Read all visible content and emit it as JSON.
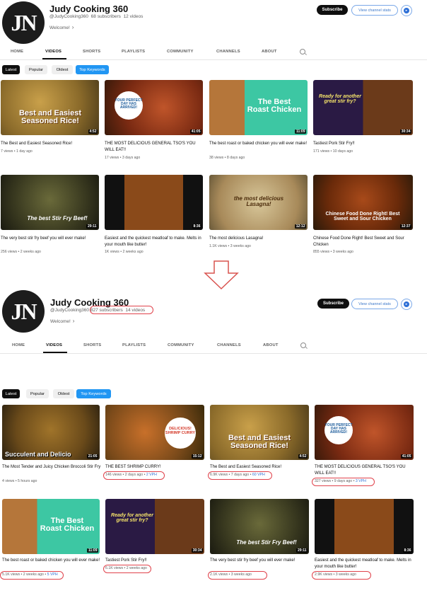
{
  "before": {
    "channel": {
      "name": "Judy Cooking 360",
      "handle": "@JudyCooking360",
      "subscribers": "68 subscribers",
      "videos": "12 videos",
      "welcome": "Welcome!",
      "subscribe_label": "Subscribe",
      "stats_label": "View channel stats"
    },
    "tabs": [
      "HOME",
      "VIDEOS",
      "SHORTS",
      "PLAYLISTS",
      "COMMUNITY",
      "CHANNELS",
      "ABOUT"
    ],
    "chips": [
      "Latest",
      "Popular",
      "Oldest",
      "Top Keywords"
    ],
    "videos": [
      {
        "title": "The Best and Easiest Seasoned Rice!",
        "meta": "7 views • 1 day ago",
        "duration": "4:52",
        "thumb_text": "Best and Easiest Seasoned Rice!"
      },
      {
        "title": "THE MOST DELICIOUS GENERAL TSO'S YOU WILL EAT!!",
        "meta": "17 views • 3 days ago",
        "duration": "41:05",
        "thumb_text": "YOUR PERFECT DAY HAS ARRIVED!"
      },
      {
        "title": "The best roast or baked chicken you will ever make!",
        "meta": "38 views • 8 days ago",
        "duration": "11:09",
        "thumb_text": "The Best Roast Chicken"
      },
      {
        "title": "Tastiest Pork Stir Fry!!",
        "meta": "171 views • 10 days ago",
        "duration": "30:34",
        "thumb_text": "Ready for another great stir fry?"
      },
      {
        "title": "The very best stir fry beef you will ever make!",
        "meta": "256 views • 2 weeks ago",
        "duration": "29:11",
        "thumb_text": "The best Stir Fry Beef!"
      },
      {
        "title": "Easiest and the quickest meatloaf to make. Melts in your mouth like butter!",
        "meta": "1K views • 2 weeks ago",
        "duration": "8:36",
        "thumb_text": ""
      },
      {
        "title": "The most delicious Lasagna!",
        "meta": "1.1K views • 3 weeks ago",
        "duration": "12:12",
        "thumb_text": "the most delicious Lasagna!"
      },
      {
        "title": "Chinese Food Done Right! Best Sweet and Sour Chicken",
        "meta": "855 views • 3 weeks ago",
        "duration": "12:37",
        "thumb_text": "Chinese Food Done Right! Best Sweet and Sour Chicken"
      }
    ]
  },
  "after": {
    "channel": {
      "name": "Judy Cooking 360",
      "handle": "@JudyCooking360",
      "subscribers": "827 subscribers",
      "videos": "14 videos",
      "welcome": "Welcome!",
      "subscribe_label": "Subscribe",
      "stats_label": "View channel stats"
    },
    "tabs": [
      "HOME",
      "VIDEOS",
      "SHORTS",
      "PLAYLISTS",
      "COMMUNITY",
      "CHANNELS",
      "ABOUT"
    ],
    "chips": [
      "Latest",
      "Popular",
      "Oldest",
      "Top Keywords"
    ],
    "videos": [
      {
        "title": "The Most Tender and Juicy Chicken Broccoli Stir Fry",
        "meta": "4 views • 5 hours ago",
        "vph": "",
        "duration": "21:05",
        "thumb_text": "Succulent and Delicio"
      },
      {
        "title": "THE BEST SHRIMP CURRY!",
        "meta": "146 views • 2 days ago •",
        "vph": "2 VPH",
        "duration": "15:12",
        "thumb_text": "DELICIOUS! SHRIMP CURRY"
      },
      {
        "title": "The Best and Easiest Seasoned Rice!",
        "meta": "6.9K views • 7 days ago •",
        "vph": "60 VPH",
        "duration": "4:52",
        "thumb_text": "Best and Easiest Seasoned Rice!"
      },
      {
        "title": "THE MOST DELICIOUS GENERAL TSO'S YOU WILL EAT!!",
        "meta": "327 views • 9 days ago •",
        "vph": "3 VPH",
        "duration": "41:05",
        "thumb_text": "YOUR PERFECT DAY HAS ARRIVED!"
      },
      {
        "title": "The best roast or baked chicken you will ever make!",
        "meta": "5.1K views • 2 weeks ago •",
        "vph": "5 VPH",
        "duration": "11:09",
        "thumb_text": "The Best Roast Chicken"
      },
      {
        "title": "Tastiest Pork Stir Fry!!",
        "meta": "6.1K views • 2 weeks ago",
        "vph": "",
        "duration": "30:34",
        "thumb_text": "Ready for another great stir fry?"
      },
      {
        "title": "The very best stir fry beef you will ever make!",
        "meta": "2.1K views • 3 weeks ago",
        "vph": "",
        "duration": "29:11",
        "thumb_text": "The best Stir Fry Beef!"
      },
      {
        "title": "Easiest and the quickest meatloaf to make. Melts in your mouth like butter!",
        "meta": "2.9K views • 3 weeks ago",
        "vph": "",
        "duration": "8:36",
        "thumb_text": ""
      }
    ]
  }
}
